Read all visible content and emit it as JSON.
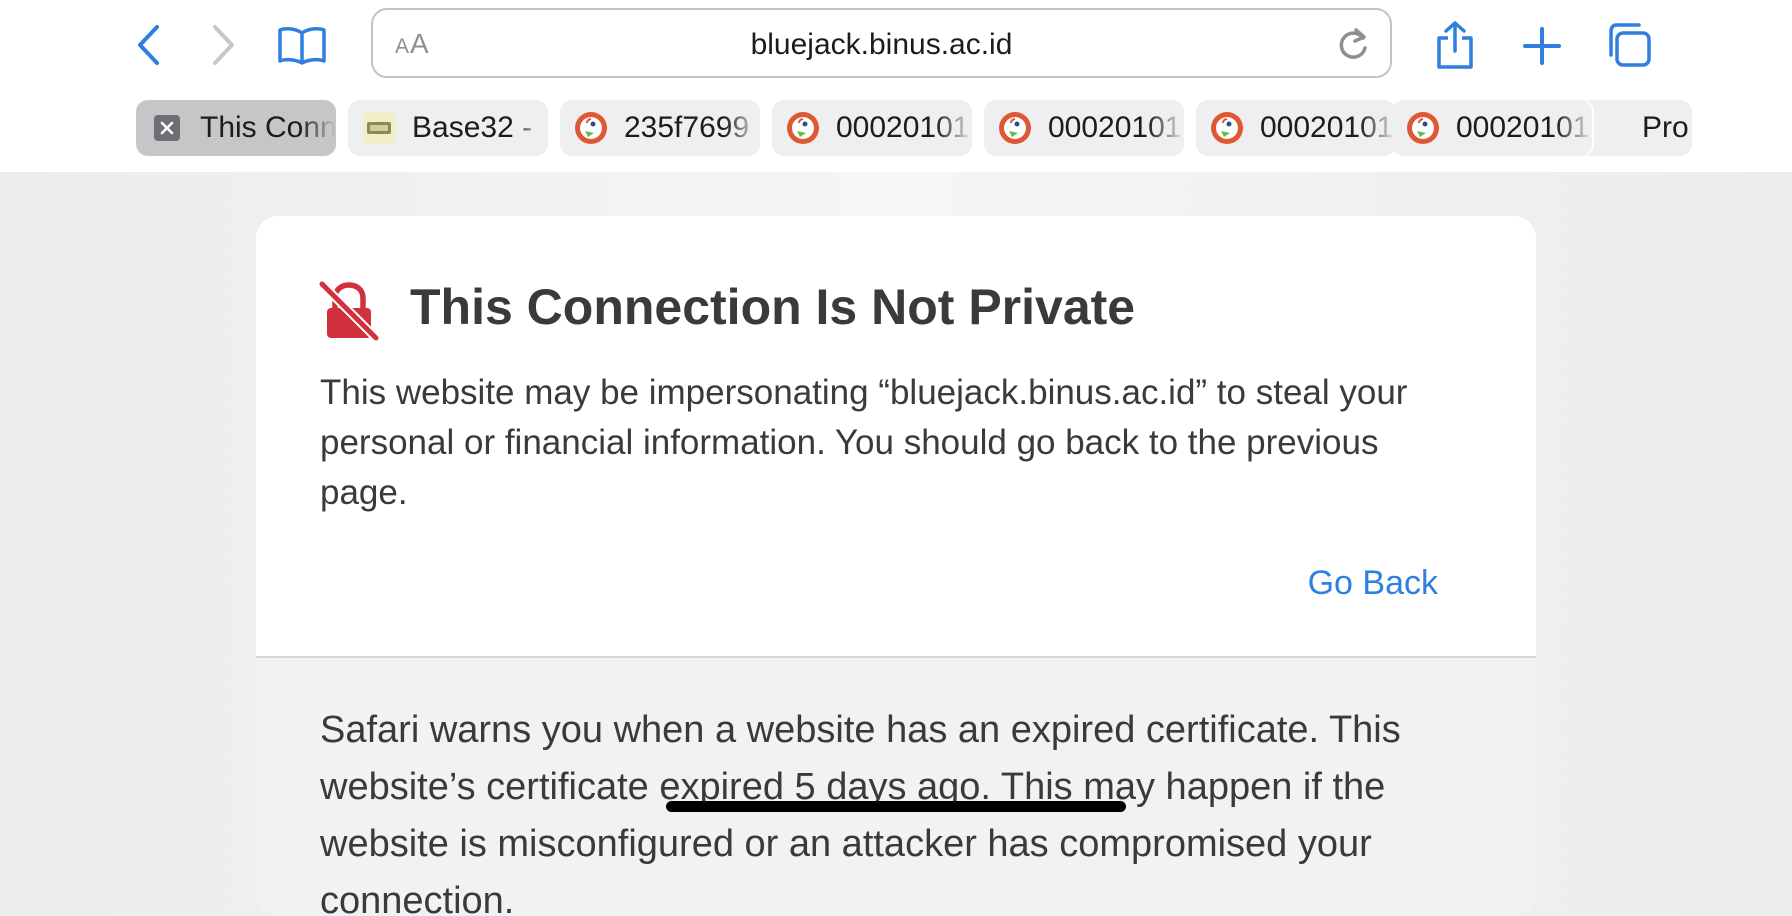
{
  "toolbar": {
    "url": "bluejack.binus.ac.id",
    "reader_small": "A",
    "reader_large": "A"
  },
  "tabs": [
    {
      "label": "This Connection Is Not Private",
      "icon": "close-icon",
      "active": true
    },
    {
      "label": "Base32 - ",
      "icon": "base32-favicon",
      "active": false
    },
    {
      "label": "235f7699",
      "icon": "duckduckgo-icon",
      "active": false
    },
    {
      "label": "00020101",
      "icon": "duckduckgo-icon",
      "active": false
    },
    {
      "label": "00020101",
      "icon": "duckduckgo-icon",
      "active": false
    },
    {
      "label": "00020101",
      "icon": "duckduckgo-icon",
      "active": false
    },
    {
      "label": "00020101",
      "icon": "duckduckgo-icon",
      "active": false
    },
    {
      "label": "Pro",
      "icon": "",
      "active": false
    }
  ],
  "warning": {
    "title": "This Connection Is Not Private",
    "description": "This website may be impersonating “bluejack.binus.ac.id” to steal your personal or financial information. You should go back to the previous page.",
    "go_back": "Go Back",
    "detail": "Safari warns you when a website has an expired certificate. This website’s certificate expired 5 days ago. This may happen if the website is misconfigured or an attacker has compromised your connection."
  },
  "colors": {
    "accent": "#2f7fe0",
    "warning_red": "#d0313d",
    "duckduckgo": "#de5833"
  }
}
